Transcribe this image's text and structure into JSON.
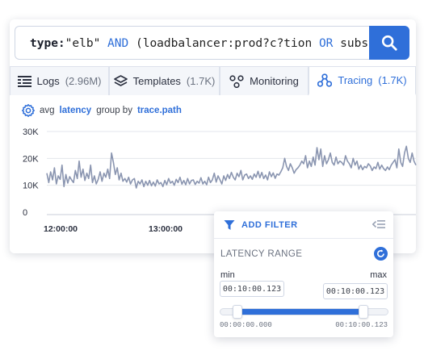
{
  "search": {
    "query_parts": [
      {
        "text": "type:",
        "style": "kw"
      },
      {
        "text": "\"elb\" ",
        "style": "plain"
      },
      {
        "text": "AND",
        "style": "op"
      },
      {
        "text": " (loadbalancer:prod?c?tion ",
        "style": "plain"
      },
      {
        "text": "OR",
        "style": "op"
      },
      {
        "text": " subsys",
        "style": "plain"
      }
    ],
    "button_icon": "search-icon"
  },
  "tabs": [
    {
      "label": "Logs",
      "count": "(2.96M)",
      "icon": "list-icon",
      "active": false
    },
    {
      "label": "Templates",
      "count": "(1.7K)",
      "icon": "layers-icon",
      "active": false
    },
    {
      "label": "Monitoring",
      "count": "",
      "icon": "nodes-icon",
      "active": false
    },
    {
      "label": "Tracing",
      "count": "(1.7K)",
      "icon": "tracing-icon",
      "active": true
    }
  ],
  "chart_header": {
    "prefix": "avg",
    "metric": "latency",
    "middle": "group by",
    "group": "trace.path",
    "icon": "gear-icon"
  },
  "chart_data": {
    "type": "line",
    "title": "avg latency group by trace.path",
    "y_ticks": [
      "30K",
      "20K",
      "10K",
      "0"
    ],
    "y_tick_values": [
      30000,
      20000,
      10000,
      0
    ],
    "ylim": [
      0,
      30000
    ],
    "x_ticks": [
      "12:00:00",
      "13:00:00"
    ],
    "grid": true,
    "color": "#8a95b0",
    "values": [
      14500,
      11000,
      15000,
      12000,
      16500,
      10500,
      13500,
      12200,
      17500,
      9500,
      14000,
      10800,
      13200,
      12000,
      11000,
      15500,
      12500,
      19000,
      13000,
      16000,
      11800,
      14500,
      12500,
      17500,
      11000,
      13500,
      10500,
      12200,
      15000,
      11500,
      14500,
      13000,
      16000,
      12500,
      22000,
      18500,
      14000,
      16500,
      12000,
      14500,
      11500,
      12500,
      11200,
      13000,
      10500,
      12000,
      12500,
      9000,
      11500,
      10500,
      12000,
      9500,
      11500,
      10000,
      11800,
      9800,
      11200,
      9700,
      12000,
      10500,
      11000,
      9500,
      11800,
      10200,
      12500,
      10800,
      11500,
      10000,
      12200,
      11000,
      13000,
      10400,
      11800,
      10200,
      12500,
      10500,
      11800,
      12000,
      10300,
      11500,
      10800,
      12800,
      10500,
      11500,
      10200,
      13000,
      11000,
      12000,
      14500,
      11200,
      13500,
      12000,
      10500,
      13500,
      11800,
      14000,
      12500,
      14800,
      13000,
      12000,
      14500,
      13200,
      15500,
      12000,
      13800,
      14200,
      12500,
      13500,
      12200,
      14200,
      13000,
      15200,
      12800,
      14800,
      12500,
      13800,
      12000,
      15000,
      13200,
      14600,
      12600,
      14200,
      13800,
      15000,
      16500,
      20000,
      17000,
      15500,
      18000,
      16500,
      14500,
      15800,
      16500,
      17500,
      19000,
      18000,
      21000,
      16500,
      19000,
      17000,
      20500,
      17500,
      24000,
      19500,
      23500,
      17000,
      21000,
      18000,
      19500,
      22000,
      18500,
      17500,
      20500,
      18000,
      19000,
      18500,
      17500,
      21000,
      19000,
      18000,
      16500,
      20000,
      17500,
      19000,
      16000,
      17500,
      15800,
      17000,
      16500,
      18000,
      17200,
      15500,
      16800,
      16200,
      18500,
      16000,
      17500,
      16200,
      15500,
      16800,
      15800,
      17500,
      18500,
      19500,
      16500,
      23500,
      18500,
      17000,
      22000,
      24500,
      20000,
      18500,
      22000,
      19000,
      17500
    ],
    "series_name": "avg latency"
  },
  "filter": {
    "title": "ADD FILTER",
    "filter_icon": "funnel-icon",
    "collapse_icon": "collapse-icon",
    "range_label": "LATENCY RANGE",
    "reset_icon": "reset-icon",
    "min_label": "min",
    "max_label": "max",
    "min_value": "00:10:00.123",
    "max_value": "00:10:00.123",
    "range_start": "00:00:00.000",
    "range_end": "00:10:00.123",
    "slider_low_fraction": 0.08,
    "slider_high_fraction": 0.83
  }
}
